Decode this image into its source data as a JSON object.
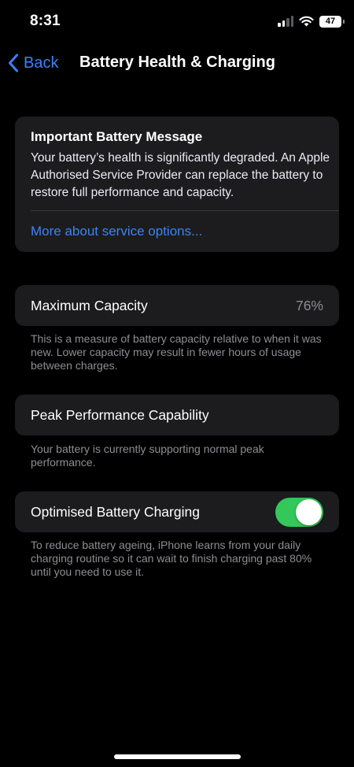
{
  "status_bar": {
    "time": "8:31",
    "battery_level": "47"
  },
  "nav": {
    "back_label": "Back",
    "title": "Battery Health & Charging"
  },
  "message": {
    "title": "Important Battery Message",
    "body": "Your battery’s health is significantly degraded. An Apple Authorised Service Provider can replace the battery to restore full performance and capacity.",
    "link": "More about service options..."
  },
  "max_capacity": {
    "label": "Maximum Capacity",
    "value": "76%",
    "footnote": "This is a measure of battery capacity relative to when it was new. Lower capacity may result in fewer hours of usage between charges."
  },
  "peak_performance": {
    "label": "Peak Performance Capability",
    "footnote": "Your battery is currently supporting normal peak performance."
  },
  "optimised_charging": {
    "label": "Optimised Battery Charging",
    "enabled": true,
    "footnote": "To reduce battery ageing, iPhone learns from your daily charging routine so it can wait to finish charging past 80% until you need to use it."
  },
  "colors": {
    "accent": "#3b82f6",
    "toggle_on": "#34c759",
    "card_bg": "#1c1c1e",
    "secondary_text": "#8e8e93"
  }
}
